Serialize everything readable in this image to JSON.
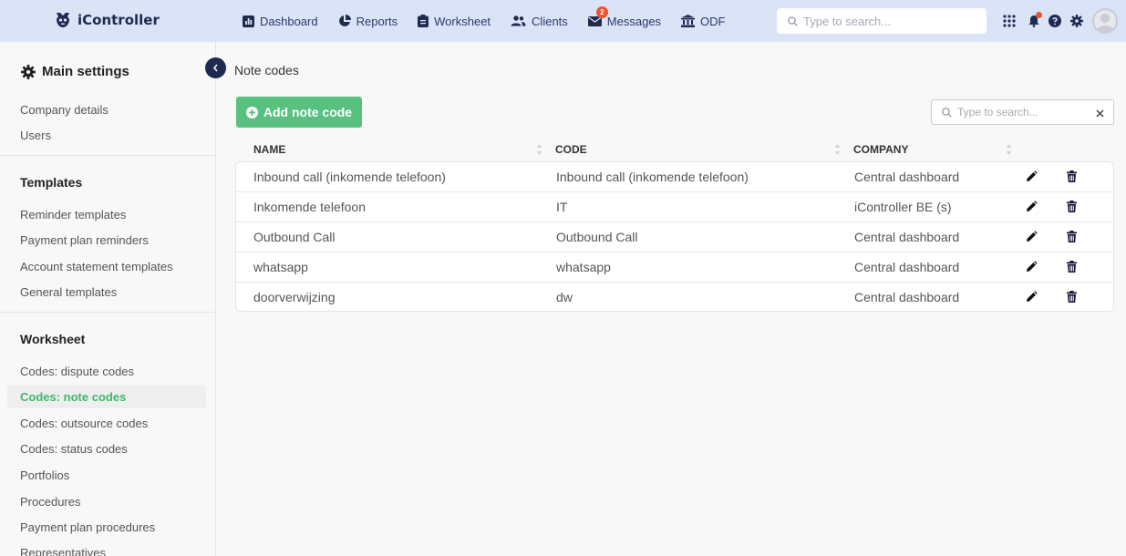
{
  "app": {
    "name": "iController"
  },
  "nav": [
    {
      "label": "Dashboard",
      "icon": "chart-icon"
    },
    {
      "label": "Reports",
      "icon": "pie-chart-icon"
    },
    {
      "label": "Worksheet",
      "icon": "clipboard-icon"
    },
    {
      "label": "Clients",
      "icon": "users-icon"
    },
    {
      "label": "Messages",
      "icon": "envelope-icon",
      "badge": "2"
    },
    {
      "label": "ODF",
      "icon": "bank-icon"
    }
  ],
  "top_search": {
    "placeholder": "Type to search..."
  },
  "sidebar": {
    "heading": "Main settings",
    "main_links": [
      "Company details",
      "Users"
    ],
    "templates": {
      "title": "Templates",
      "links": [
        "Reminder templates",
        "Payment plan reminders",
        "Account statement templates",
        "General templates"
      ]
    },
    "worksheet": {
      "title": "Worksheet",
      "links": [
        "Codes: dispute codes",
        "Codes: note codes",
        "Codes: outsource codes",
        "Codes: status codes",
        "Portfolios",
        "Procedures",
        "Payment plan procedures",
        "Representatives"
      ],
      "active": "Codes: note codes"
    }
  },
  "page": {
    "title": "Note codes",
    "add_button": "Add note code",
    "search_placeholder": "Type to search...",
    "columns": [
      "NAME",
      "CODE",
      "COMPANY"
    ],
    "rows": [
      {
        "name": "Inbound call (inkomende telefoon)",
        "code": "Inbound call (inkomende telefoon)",
        "company": "Central dashboard"
      },
      {
        "name": "Inkomende telefoon",
        "code": "IT",
        "company": "iController BE (s)"
      },
      {
        "name": "Outbound Call",
        "code": "Outbound Call",
        "company": "Central dashboard"
      },
      {
        "name": "whatsapp",
        "code": "whatsapp",
        "company": "Central dashboard"
      },
      {
        "name": "doorverwijzing",
        "code": "dw",
        "company": "Central dashboard"
      }
    ]
  },
  "colors": {
    "topbar": "#dbe3f7",
    "navy": "#1f2a50",
    "accent_green": "#58c17f",
    "active_link": "#3fb86c",
    "badge": "#e8542e"
  }
}
